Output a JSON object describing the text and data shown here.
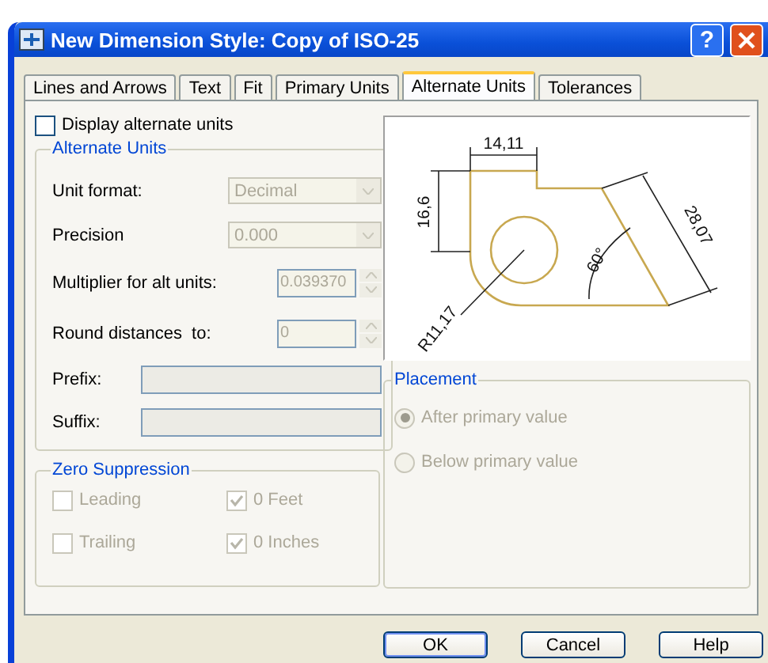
{
  "window": {
    "title": "New Dimension Style: Copy of ISO-25",
    "help_glyph": "?"
  },
  "tabs": [
    {
      "label": "Lines and Arrows",
      "selected": false
    },
    {
      "label": "Text",
      "selected": false
    },
    {
      "label": "Fit",
      "selected": false
    },
    {
      "label": "Primary Units",
      "selected": false
    },
    {
      "label": "Alternate Units",
      "selected": true
    },
    {
      "label": "Tolerances",
      "selected": false
    }
  ],
  "display_alternate_units": {
    "label": "Display alternate units",
    "checked": false
  },
  "alternate_units": {
    "title": "Alternate Units",
    "fields": [
      {
        "kind": "dropdown",
        "label": "Unit format:",
        "value": "Decimal",
        "disabled": true
      },
      {
        "kind": "dropdown",
        "label": "Precision",
        "value": "0.000",
        "disabled": true
      },
      {
        "kind": "spinner",
        "label": "Multiplier for alt units:",
        "value": "0.039370",
        "disabled": true
      },
      {
        "kind": "spinner",
        "label": "Round distances  to:",
        "value": "0",
        "disabled": true
      },
      {
        "kind": "text",
        "label": "Prefix:",
        "disabled": true
      },
      {
        "kind": "text",
        "label": "Suffix:",
        "disabled": true
      }
    ]
  },
  "zero_suppression": {
    "title": "Zero Suppression",
    "options": [
      {
        "label": "Leading",
        "checked": false,
        "disabled": true
      },
      {
        "label": "0 Feet",
        "checked": true,
        "disabled": true
      },
      {
        "label": "Trailing",
        "checked": false,
        "disabled": true
      },
      {
        "label": "0 Inches",
        "checked": true,
        "disabled": true
      }
    ]
  },
  "preview": {
    "labels": [
      "14,11",
      "16,6",
      "28,07",
      "60°",
      "R11,17"
    ]
  },
  "placement": {
    "title": "Placement",
    "options": [
      {
        "label": "After primary value",
        "selected": true,
        "disabled": true
      },
      {
        "label": "Below primary value",
        "selected": false,
        "disabled": true
      }
    ]
  },
  "buttons": [
    "OK",
    "Cancel",
    "Help"
  ]
}
